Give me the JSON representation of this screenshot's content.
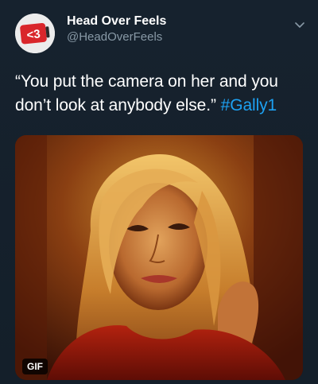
{
  "tweet": {
    "display_name": "Head Over Feels",
    "handle": "@HeadOverFeels",
    "avatar_text": "<3",
    "text_main": "“You put the camera on her and you don’t look at anybody else.”",
    "hashtag": "#Gally1",
    "media_badge": "GIF"
  },
  "icons": {
    "avatar": "heart-logo-icon",
    "menu": "chevron-down-icon"
  },
  "colors": {
    "background": "#15202b",
    "link": "#1da1f2",
    "secondary_text": "#8899a6",
    "logo_red": "#d9262b"
  }
}
